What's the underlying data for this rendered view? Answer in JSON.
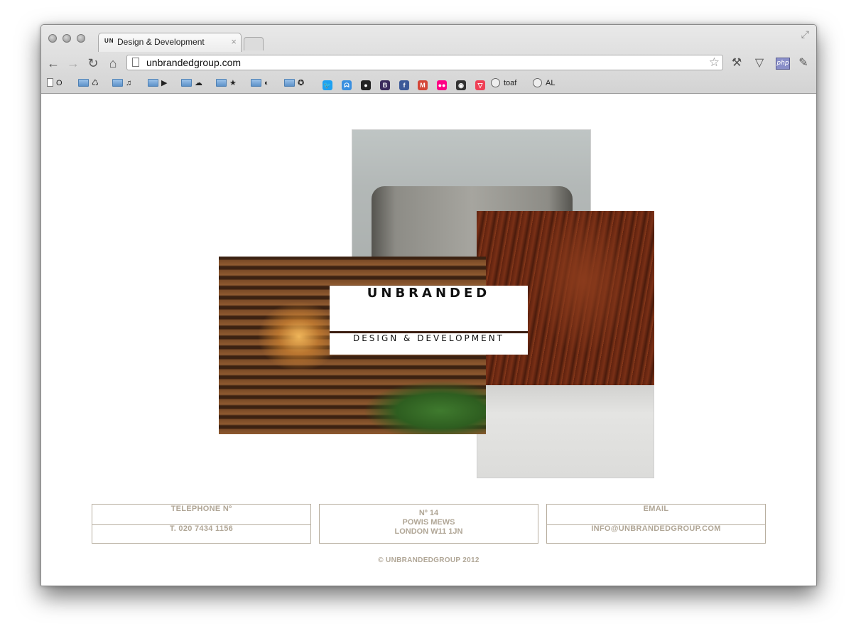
{
  "browser": {
    "tab_logo": "UN",
    "tab_title": "Design & Development",
    "tab_close": "×",
    "url": "unbrandedgroup.com",
    "nav": {
      "back": "←",
      "forward": "→",
      "reload": "↻",
      "home": "⌂"
    },
    "star": "☆",
    "tools": {
      "wrench": "🔧",
      "pocket": "▽",
      "php": "php"
    },
    "bookmarks": [
      {
        "kind": "doc",
        "label": "O"
      },
      {
        "kind": "folder",
        "label": "♺"
      },
      {
        "kind": "folder",
        "label": "♫"
      },
      {
        "kind": "folder",
        "label": "▶"
      },
      {
        "kind": "folder",
        "label": "☁"
      },
      {
        "kind": "folder",
        "label": "★"
      },
      {
        "kind": "folder",
        "label": "◐"
      },
      {
        "kind": "folder",
        "label": "✪"
      }
    ],
    "bookmark_apps": [
      {
        "name": "twitter",
        "glyph": "🐦",
        "color": "#1da1f2"
      },
      {
        "name": "pacman",
        "glyph": "ᗣ",
        "color": "#3a8fe0"
      },
      {
        "name": "github",
        "glyph": "●",
        "color": "#222222"
      },
      {
        "name": "blogger",
        "glyph": "B",
        "color": "#3b2a5c"
      },
      {
        "name": "facebook",
        "glyph": "f",
        "color": "#3b5998"
      },
      {
        "name": "gmail",
        "glyph": "M",
        "color": "#d44638"
      },
      {
        "name": "flickr",
        "glyph": "●●",
        "color": "#ff0084"
      },
      {
        "name": "panda",
        "glyph": "◉",
        "color": "#333333"
      },
      {
        "name": "pocket",
        "glyph": "▽",
        "color": "#ef4056"
      }
    ],
    "bookmark_text": [
      {
        "label": "toaf"
      },
      {
        "label": "AL"
      }
    ]
  },
  "hero": {
    "brand": "UNBRANDED",
    "tagline": "DESIGN & DEVELOPMENT"
  },
  "contact": {
    "telephone_heading": "TELEPHONE Nº",
    "telephone_value": "T. 020 7434 1156",
    "address_line1": "Nº 14",
    "address_line2": "POWIS MEWS",
    "address_line3": "LONDON W11 1JN",
    "email_heading": "EMAIL",
    "email_value": "INFO@UNBRANDEDGROUP.COM"
  },
  "footer": "© UNBRANDEDGROUP 2012"
}
